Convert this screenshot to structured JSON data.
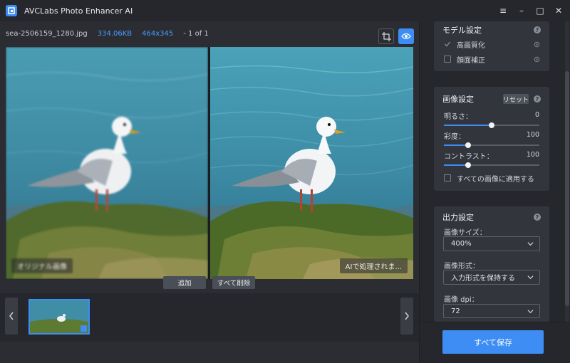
{
  "app": {
    "title": "AVCLabs Photo Enhancer AI",
    "window_controls": [
      "≡",
      "–",
      "□",
      "✕"
    ]
  },
  "file_info": {
    "name": "sea-2506159_1280.jpg",
    "size": "334.06KB",
    "dimensions": "464x345",
    "page": "- 1 of 1"
  },
  "viewer": {
    "left_label": "オリジナル画像",
    "right_label": "AIで処理されま..."
  },
  "actions": {
    "add_label": "追加",
    "delete_all_label": "すべて削除"
  },
  "model_settings": {
    "title": "モデル設定",
    "items": [
      {
        "label": "高画質化",
        "checked": true
      },
      {
        "label": "顔面補正",
        "checked": false
      }
    ]
  },
  "image_settings": {
    "title": "画像設定",
    "reset_label": "リセット",
    "sliders": [
      {
        "label": "明るさ：",
        "value": "0",
        "fraction": 0.5
      },
      {
        "label": "彩度：",
        "value": "100",
        "fraction": 0.25
      },
      {
        "label": "コントラスト：",
        "value": "100",
        "fraction": 0.25
      }
    ],
    "apply_all_label": "すべての画像に適用する"
  },
  "output_settings": {
    "title": "出力設定",
    "size_label": "画像サイズ：",
    "size_value": "400%",
    "format_label": "画像形式：",
    "format_value": "入力形式を保持する",
    "dpi_label": "画像 dpi：",
    "dpi_value": "72"
  },
  "save_all_label": "すべて保存",
  "colors": {
    "accent": "#3d8df5",
    "panel": "#32353c",
    "background": "#2b2d33"
  }
}
